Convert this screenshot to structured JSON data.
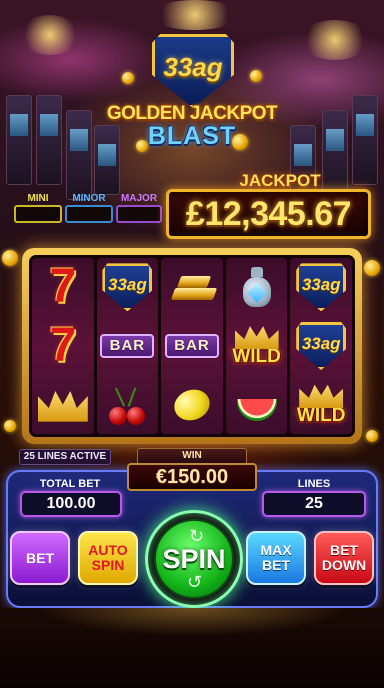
{
  "logo": {
    "badge": "33ag",
    "title_line1": "GOLDEN JACKPOT",
    "title_line2": "BLAST"
  },
  "progressive": {
    "mini_label": "MINI",
    "minor_label": "MINOR",
    "major_label": "MAJOR",
    "colors": {
      "mini": "#f2e64a",
      "minor": "#5ab8ff",
      "major": "#d07aff"
    }
  },
  "jackpot": {
    "label": "JACKPOT",
    "amount": "£12,345.67"
  },
  "reels": {
    "symbols": [
      [
        "seven",
        "seven",
        "wild-crown"
      ],
      [
        "shield-33ag",
        "bar",
        "cherry"
      ],
      [
        "gold-bars",
        "bar",
        "lemon"
      ],
      [
        "diamond-bag",
        "wild",
        "watermelon"
      ],
      [
        "shield-33ag",
        "shield-33ag",
        "wild"
      ]
    ],
    "seven_text": "7",
    "shield_text": "33ag",
    "bar_text": "BAR",
    "wild_text": "WILD"
  },
  "status": {
    "lines_active": "25 LINES ACTIVE",
    "win_label": "WIN",
    "win_amount": "€150.00"
  },
  "controls": {
    "total_bet_label": "TOTAL BET",
    "total_bet_value": "100.00",
    "lines_label": "LINES",
    "lines_value": "25",
    "bet_button": "BET",
    "auto_spin_line1": "AUTO",
    "auto_spin_line2": "SPIN",
    "spin_button": "SPIN",
    "max_bet_line1": "MAX",
    "max_bet_line2": "BET",
    "bet_down_line1": "BET",
    "bet_down_line2": "DOWN"
  },
  "theme": {
    "gold": "#f5c542",
    "spin_green": "#13b41a",
    "panel_blue": "#1e2a7a"
  }
}
